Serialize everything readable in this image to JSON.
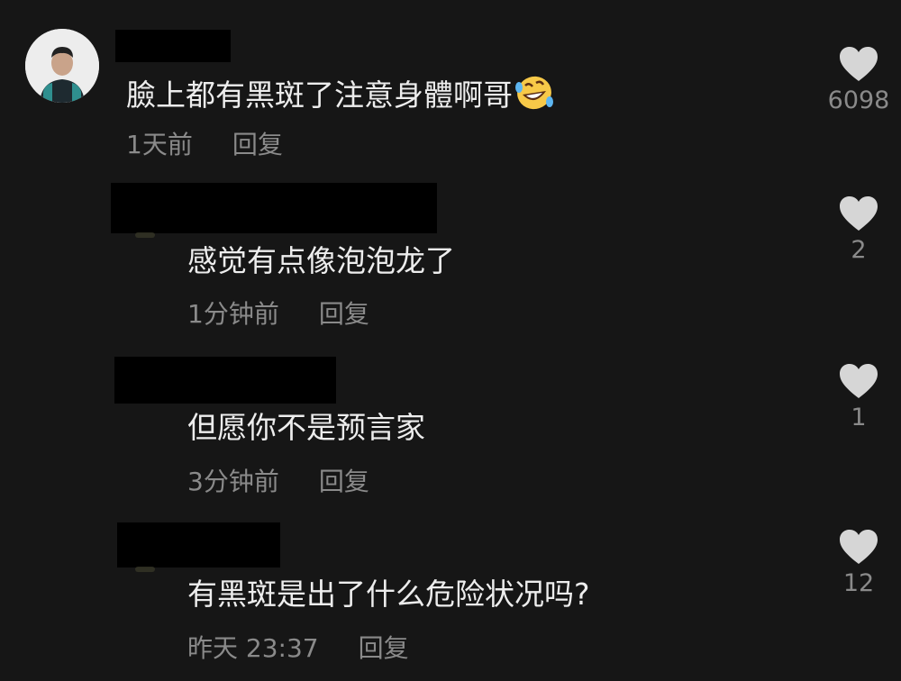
{
  "comments": [
    {
      "text": "臉上都有黑斑了注意身體啊哥",
      "time": "1天前",
      "reply_label": "回复",
      "likes": "6098",
      "emoji": "rolling-on-floor-laughing"
    },
    {
      "text": "感觉有点像泡泡龙了",
      "time": "1分钟前",
      "reply_label": "回复",
      "likes": "2"
    },
    {
      "text": "但愿你不是预言家",
      "time": "3分钟前",
      "reply_label": "回复",
      "likes": "1"
    },
    {
      "text": "有黑斑是出了什么危险状况吗?",
      "time": "昨天 23:37",
      "reply_label": "回复",
      "likes": "12"
    }
  ],
  "colors": {
    "background": "#161616",
    "text": "#ededed",
    "meta": "#8a8a8a",
    "heart": "#d6d6d6",
    "redaction": "#000000"
  },
  "icons": {
    "like": "heart-icon",
    "emoji": "laughing-tears-emoji-icon"
  }
}
